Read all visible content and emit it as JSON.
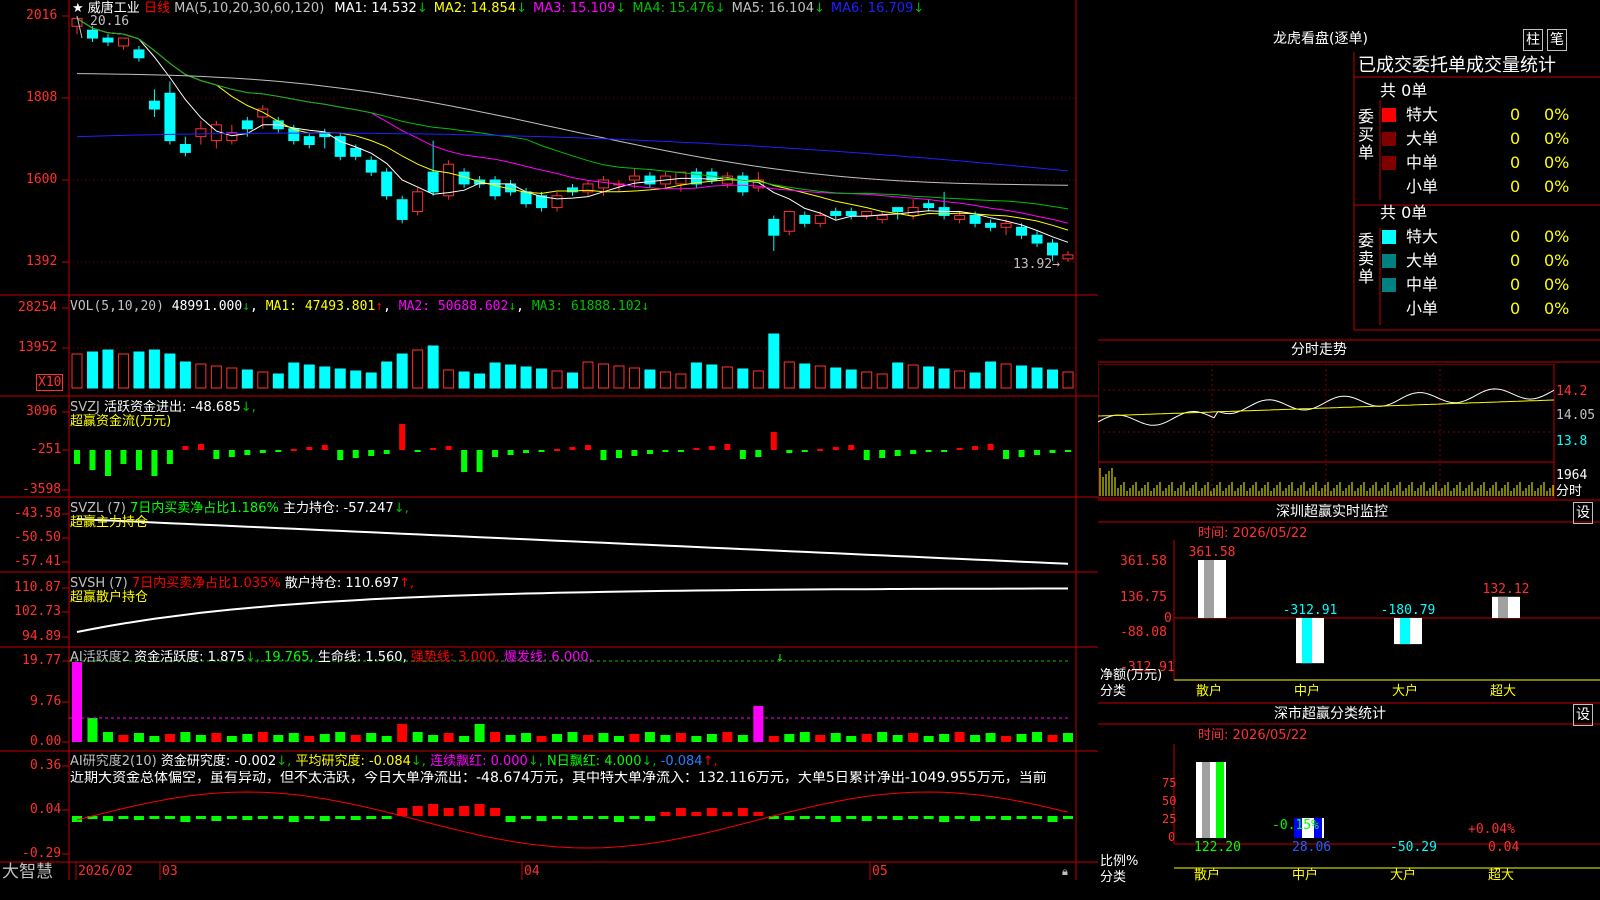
{
  "stock": {
    "star": "★",
    "name": "威唐工业",
    "period": "日线",
    "ma_label": "MA(5,10,20,30,60,120)",
    "ma": [
      {
        "label": "MA1:",
        "value": "14.532",
        "arrow": "↓",
        "color": "#ffffff"
      },
      {
        "label": "MA2:",
        "value": "14.854",
        "arrow": "↓",
        "color": "#ffff00"
      },
      {
        "label": "MA3:",
        "value": "15.109",
        "arrow": "↓",
        "color": "#ff00ff"
      },
      {
        "label": "MA4:",
        "value": "15.476",
        "arrow": "↓",
        "color": "#00c000"
      },
      {
        "label": "MA5:",
        "value": "16.104",
        "arrow": "↓",
        "color": "#c0c0c0"
      },
      {
        "label": "MA6:",
        "value": "16.709",
        "arrow": "↓",
        "color": "#2020ff"
      }
    ],
    "high_label": "20.16",
    "low_label": "13.92"
  },
  "axes": {
    "price": [
      "2016",
      "1808",
      "1600",
      "1392"
    ],
    "vol": [
      "28254",
      "13952"
    ],
    "vol_unit": "X10",
    "svzj": [
      "3096",
      "-251",
      "-3598"
    ],
    "svzl": [
      "-43.58",
      "-50.50",
      "-57.41"
    ],
    "svsh": [
      "110.87",
      "102.73",
      "94.89"
    ],
    "ai1": [
      "19.77",
      "9.76",
      "0.00"
    ],
    "ai2": [
      "0.36",
      "0.04",
      "-0.29"
    ]
  },
  "vol_panel": {
    "label": "VOL(5,10,20)",
    "value": "48991.000",
    "arrow": "↓",
    "ma1": "MA1: 47493.801",
    "ma1_arrow": "↑",
    "ma2": "MA2: 50688.602",
    "ma2_arrow": "↓",
    "ma3": "MA3: 61888.102",
    "ma3_arrow": "↓"
  },
  "svzj_panel": {
    "label": "SVZJ",
    "desc": "活跃资金进出:",
    "value": "-48.685",
    "arrow": "↓,",
    "subtitle": "超赢资金流(万元)"
  },
  "svzl_panel": {
    "label": "SVZL (7)",
    "desc1": "7日内买卖净占比1.186%",
    "desc2": "主力持仓:",
    "value": "-57.247",
    "arrow": "↓,",
    "subtitle": "超赢主力持仓"
  },
  "svsh_panel": {
    "label": "SVSH (7)",
    "desc1": "7日内买卖净占比1.035%",
    "desc2": "散户持仓:",
    "value": "110.697",
    "arrow": "↑,",
    "subtitle": "超赢散户持仓"
  },
  "ai1_panel": {
    "label": "AI活跃度2",
    "desc": "资金活跃度:",
    "value": "1.875",
    "arrow": "↓,",
    "v2": "19.765,",
    "life": "生命线:",
    "life_val": "1.560,",
    "strong": "强势线:",
    "strong_val": "3.000,",
    "burst": "爆发线:",
    "burst_val": "6.000,"
  },
  "ai2_panel": {
    "label": "AI研究度2(10)",
    "desc": "资金研究度:",
    "value": "-0.002",
    "arrow": "↓,",
    "avg": "平均研究度:",
    "avg_val": "-0.084",
    "avg_arrow": "↓,",
    "lianxu": "连续飘红:",
    "lianxu_val": "0.000",
    "lianxu_arrow": "↓,",
    "nri": "N日飘红:",
    "nri_val": "4.000",
    "nri_arrow": "↓,",
    "last_val": "-0.084",
    "last_arrow": "↑,",
    "commentary": "近期大资金总体偏空，虽有异动，但不太活跃，今日大单净流出：-48.674万元，其中特大单净流入：132.116万元，大单5日累计净出-1049.955万元，当前"
  },
  "bottom_bar": {
    "brand": "大智慧",
    "dates": [
      "2026/02",
      "03",
      "04",
      "05"
    ]
  },
  "right": {
    "lhb_title": "龙虎看盘(逐单)",
    "btn_zhu": "柱",
    "btn_bi": "笔",
    "table_title": "已成交委托单成交量统计",
    "buy_label": "委买单",
    "sell_label": "委卖单",
    "buy_total": "共 0单",
    "sell_total": "共 0单",
    "buy_rows": [
      {
        "name": "特大",
        "count": "0",
        "pct": "0%",
        "color": "#ff0000"
      },
      {
        "name": "大单",
        "count": "0",
        "pct": "0%",
        "color": "#800000"
      },
      {
        "name": "中单",
        "count": "0",
        "pct": "0%",
        "color": "#800000"
      },
      {
        "name": "小单",
        "count": "0",
        "pct": "0%",
        "color": ""
      }
    ],
    "sell_rows": [
      {
        "name": "特大",
        "count": "0",
        "pct": "0%",
        "color": "#00ffff"
      },
      {
        "name": "大单",
        "count": "0",
        "pct": "0%",
        "color": "#008080"
      },
      {
        "name": "中单",
        "count": "0",
        "pct": "0%",
        "color": "#008080"
      },
      {
        "name": "小单",
        "count": "0",
        "pct": "0%",
        "color": ""
      }
    ],
    "fenshi_title": "分时走势",
    "fenshi_axis": [
      "14.2",
      "14.05",
      "13.8",
      "1964",
      "分时"
    ],
    "monitor_title": "深圳超赢实时监控",
    "monitor_btn": "设",
    "monitor_time": "时间: 2026/05/22",
    "monitor_axis": [
      "361.58",
      "136.75",
      "0",
      "-88.08",
      "-312.91"
    ],
    "monitor_ylabel": "净额(万元)",
    "monitor_xlabel": "分类",
    "monitor_bars": [
      {
        "cat": "散户",
        "value": 361.58,
        "label": "361.58"
      },
      {
        "cat": "中户",
        "value": -312.91,
        "label": "-312.91"
      },
      {
        "cat": "大户",
        "value": -180.79,
        "label": "-180.79"
      },
      {
        "cat": "超大",
        "value": 132.12,
        "label": "132.12"
      }
    ],
    "stats_title": "深市超赢分类统计",
    "stats_btn": "设",
    "stats_time": "时间: 2026/05/22",
    "stats_axis": [
      "75",
      "50",
      "25",
      "0"
    ],
    "stats_ylabel": "比例%",
    "stats_xlabel": "分类",
    "stats_top_labels": [
      "-0.15%",
      "+0.04%"
    ],
    "stats_bars": [
      {
        "cat": "散户",
        "value": "122.20"
      },
      {
        "cat": "中户",
        "value": "28.06"
      },
      {
        "cat": "大户",
        "value": "-50.29"
      },
      {
        "cat": "超大",
        "value": "0.04"
      }
    ]
  },
  "chart_data": [
    {
      "type": "candlestick",
      "title": "威唐工业 日线",
      "ylim": [
        13.5,
        20.5
      ],
      "candles": [
        [
          19.9,
          20.1,
          20.16,
          19.7
        ],
        [
          19.8,
          19.6,
          19.9,
          19.5
        ],
        [
          19.6,
          19.5,
          19.7,
          19.4
        ],
        [
          19.4,
          19.6,
          19.6,
          19.3
        ],
        [
          19.3,
          19.1,
          19.4,
          19.0
        ],
        [
          18.0,
          17.8,
          18.3,
          17.6
        ],
        [
          18.2,
          17.0,
          18.5,
          16.9
        ],
        [
          16.9,
          16.7,
          17.1,
          16.6
        ],
        [
          17.1,
          17.3,
          17.5,
          16.9
        ],
        [
          17.0,
          17.4,
          17.5,
          16.8
        ],
        [
          17.0,
          17.2,
          17.4,
          16.9
        ],
        [
          17.5,
          17.3,
          17.6,
          17.1
        ],
        [
          17.6,
          17.8,
          17.9,
          17.3
        ],
        [
          17.5,
          17.3,
          17.6,
          17.2
        ],
        [
          17.3,
          17.0,
          17.4,
          16.9
        ],
        [
          17.1,
          16.9,
          17.2,
          16.8
        ],
        [
          17.2,
          17.1,
          17.3,
          16.8
        ],
        [
          17.1,
          16.6,
          17.2,
          16.5
        ],
        [
          16.8,
          16.6,
          16.9,
          16.5
        ],
        [
          16.5,
          16.2,
          16.6,
          16.1
        ],
        [
          16.2,
          15.6,
          16.3,
          15.5
        ],
        [
          15.5,
          15.0,
          15.6,
          14.9
        ],
        [
          15.2,
          15.7,
          15.8,
          15.1
        ],
        [
          16.2,
          15.7,
          17.0,
          15.6
        ],
        [
          15.6,
          16.4,
          16.5,
          15.5
        ],
        [
          16.2,
          15.9,
          16.3,
          15.8
        ],
        [
          16.0,
          15.9,
          16.1,
          15.8
        ],
        [
          16.0,
          15.6,
          16.1,
          15.5
        ],
        [
          15.9,
          15.7,
          16.0,
          15.6
        ],
        [
          15.7,
          15.4,
          15.8,
          15.3
        ],
        [
          15.6,
          15.3,
          15.7,
          15.2
        ],
        [
          15.3,
          15.6,
          15.7,
          15.2
        ],
        [
          15.8,
          15.7,
          15.9,
          15.6
        ],
        [
          15.7,
          15.9,
          16.0,
          15.6
        ],
        [
          15.8,
          16.0,
          16.1,
          15.6
        ],
        [
          15.9,
          15.9,
          16.0,
          15.7
        ],
        [
          16.0,
          16.1,
          16.3,
          15.8
        ],
        [
          16.1,
          15.9,
          16.2,
          15.8
        ],
        [
          15.9,
          16.1,
          16.2,
          15.8
        ],
        [
          15.9,
          16.2,
          16.2,
          15.7
        ],
        [
          16.2,
          15.9,
          16.3,
          15.8
        ],
        [
          16.2,
          16.0,
          16.3,
          15.9
        ],
        [
          15.9,
          16.1,
          16.2,
          15.8
        ],
        [
          16.1,
          15.7,
          16.2,
          15.6
        ],
        [
          15.8,
          16.0,
          16.2,
          15.7
        ],
        [
          15.0,
          14.6,
          15.1,
          14.2
        ],
        [
          14.7,
          15.2,
          15.2,
          14.6
        ],
        [
          15.1,
          14.9,
          15.2,
          14.8
        ],
        [
          14.9,
          15.1,
          15.2,
          14.8
        ],
        [
          15.2,
          15.1,
          15.3,
          15.0
        ],
        [
          15.2,
          15.1,
          15.3,
          15.0
        ],
        [
          15.1,
          15.2,
          15.2,
          15.0
        ],
        [
          15.0,
          15.1,
          15.2,
          14.9
        ],
        [
          15.3,
          15.2,
          15.3,
          15.0
        ],
        [
          15.1,
          15.3,
          15.5,
          15.0
        ],
        [
          15.4,
          15.3,
          15.5,
          15.2
        ],
        [
          15.3,
          15.1,
          15.7,
          15.0
        ],
        [
          15.0,
          15.1,
          15.2,
          14.9
        ],
        [
          15.1,
          14.9,
          15.2,
          14.8
        ],
        [
          14.9,
          14.8,
          15.0,
          14.7
        ],
        [
          14.8,
          14.9,
          15.0,
          14.6
        ],
        [
          14.8,
          14.6,
          14.9,
          14.5
        ],
        [
          14.6,
          14.4,
          14.7,
          14.3
        ],
        [
          14.4,
          14.1,
          14.5,
          13.95
        ],
        [
          14.0,
          14.1,
          14.2,
          13.92
        ]
      ]
    }
  ]
}
